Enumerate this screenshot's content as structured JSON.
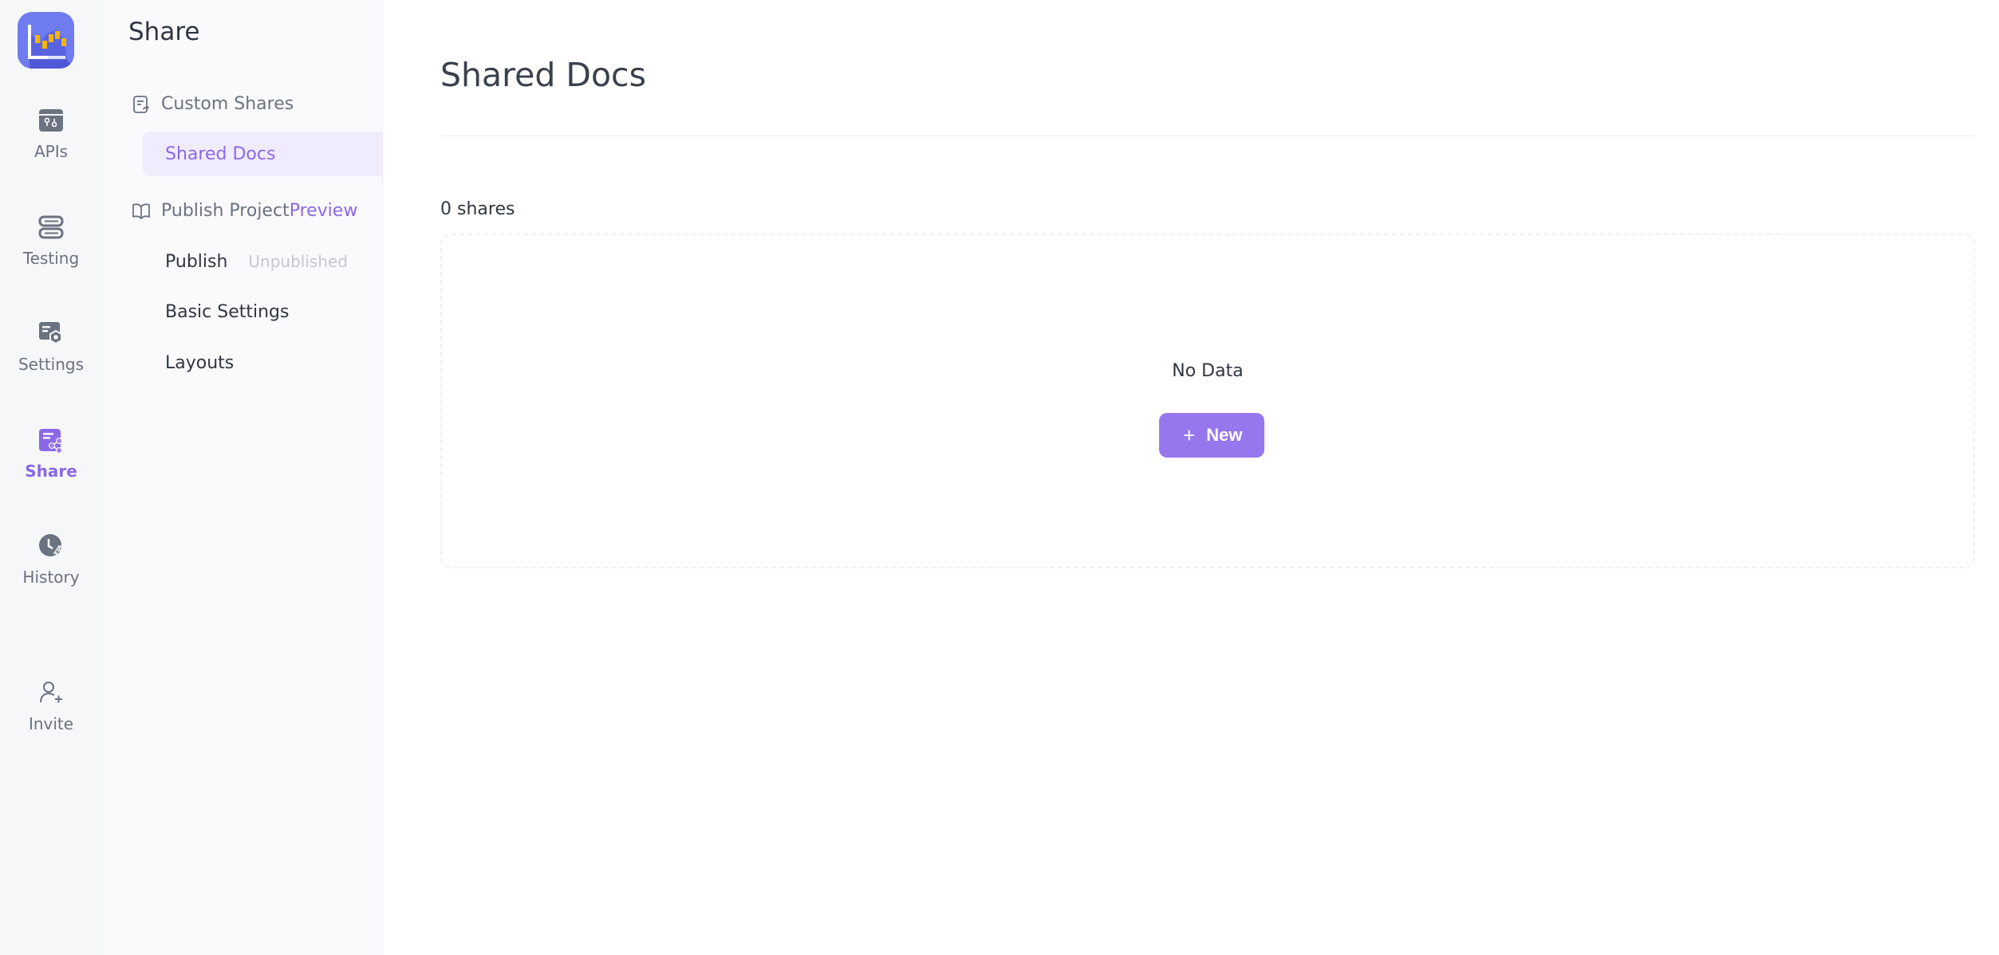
{
  "rail": {
    "items": [
      {
        "key": "apis",
        "label": "APIs",
        "icon": "api-icon",
        "active": false
      },
      {
        "key": "testing",
        "label": "Testing",
        "icon": "testing-icon",
        "active": false
      },
      {
        "key": "settings",
        "label": "Settings",
        "icon": "settings-icon",
        "active": false
      },
      {
        "key": "share",
        "label": "Share",
        "icon": "share-icon",
        "active": true
      },
      {
        "key": "history",
        "label": "History",
        "icon": "history-icon",
        "active": false
      }
    ],
    "invite": {
      "label": "Invite",
      "icon": "invite-icon"
    }
  },
  "sidebar": {
    "title": "Share",
    "custom_shares": {
      "label": "Custom Shares",
      "icon": "document-share-icon"
    },
    "shared_docs": {
      "label": "Shared Docs",
      "active": true
    },
    "publish_project": {
      "label": "Publish Project",
      "badge": "Preview",
      "icon": "book-icon"
    },
    "publish": {
      "label": "Publish",
      "status": "Unpublished"
    },
    "basic_settings": {
      "label": "Basic Settings"
    },
    "layouts": {
      "label": "Layouts"
    }
  },
  "main": {
    "title": "Shared Docs",
    "count_label": "0 shares",
    "empty_text": "No Data",
    "new_button": {
      "label": "New",
      "icon": "plus-icon"
    }
  },
  "colors": {
    "accent": "#8b68e8",
    "button": "#9776ee",
    "active_bg": "#f1ecfd",
    "muted": "#c5c7cc"
  }
}
